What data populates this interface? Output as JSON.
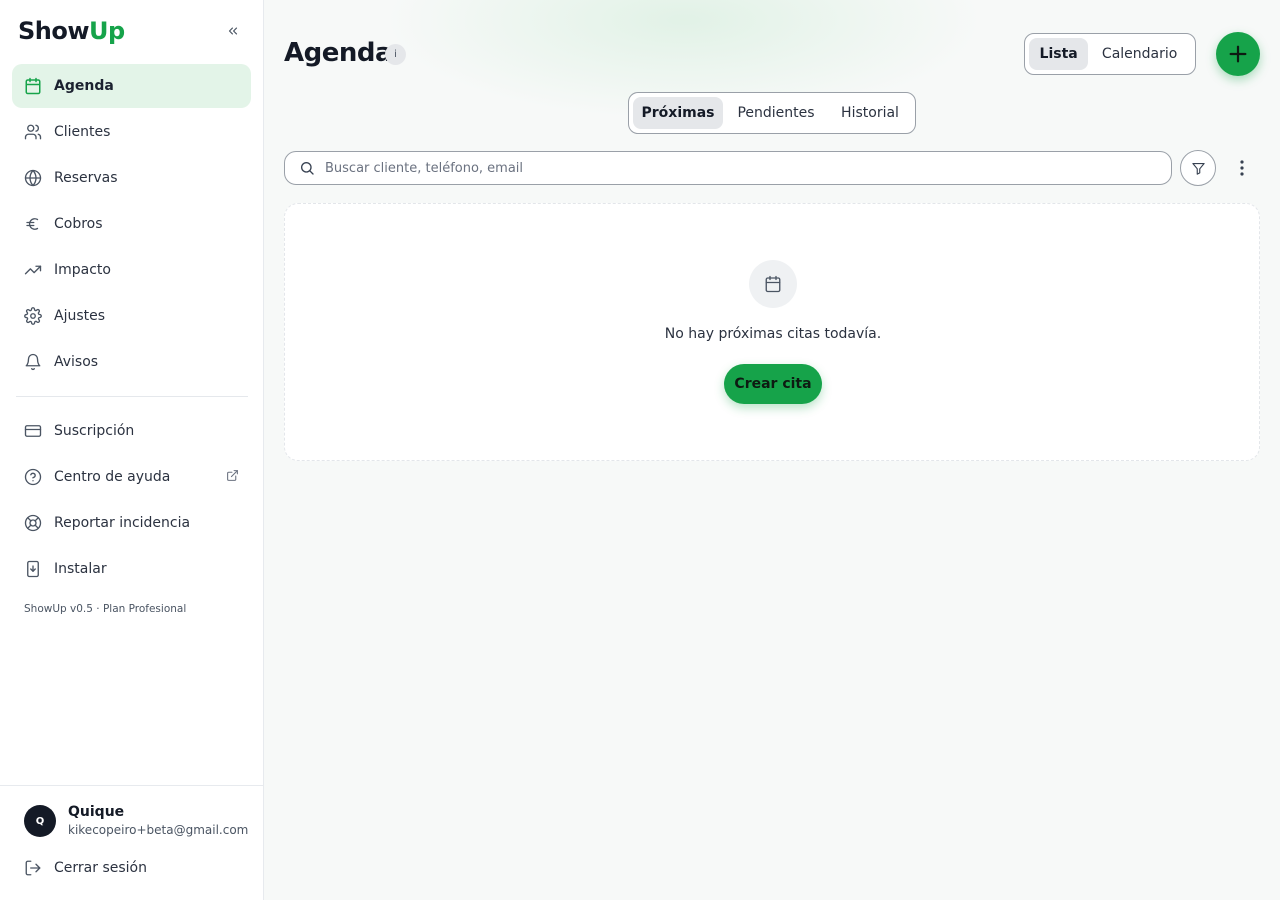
{
  "app": {
    "logo_part1": "Show",
    "logo_part2": "Up",
    "accent": "#16a34a"
  },
  "sidebar": {
    "items": [
      {
        "label": "Agenda",
        "icon": "calendar-icon",
        "active": true
      },
      {
        "label": "Clientes",
        "icon": "users-icon"
      },
      {
        "label": "Reservas",
        "icon": "globe-icon"
      },
      {
        "label": "Cobros",
        "icon": "euro-icon"
      },
      {
        "label": "Impacto",
        "icon": "trending-up-icon"
      },
      {
        "label": "Ajustes",
        "icon": "gear-icon"
      },
      {
        "label": "Avisos",
        "icon": "bell-icon"
      }
    ],
    "secondary": [
      {
        "label": "Suscripción",
        "icon": "credit-card-icon"
      },
      {
        "label": "Centro de ayuda",
        "icon": "help-circle-icon"
      },
      {
        "label": "Reportar incidencia",
        "icon": "lifebuoy-icon"
      },
      {
        "label": "Instalar",
        "icon": "install-icon"
      }
    ],
    "version": "ShowUp v0.5 · Plan Profesional",
    "user": {
      "initial": "Q",
      "name": "Quique",
      "email": "kikecopeiro+beta@gmail.com"
    },
    "logout": "Cerrar sesión"
  },
  "main": {
    "title": "Agenda",
    "info_glyph": "i",
    "view_toggle": {
      "list": "Lista",
      "calendar": "Calendario",
      "selected": "Lista"
    },
    "tabs": [
      {
        "label": "Próximas",
        "active": true
      },
      {
        "label": "Pendientes"
      },
      {
        "label": "Historial"
      }
    ],
    "search": {
      "placeholder": "Buscar cliente, teléfono, email",
      "value": ""
    },
    "empty": {
      "message": "No hay próximas citas todavía.",
      "button": "Crear cita"
    }
  }
}
